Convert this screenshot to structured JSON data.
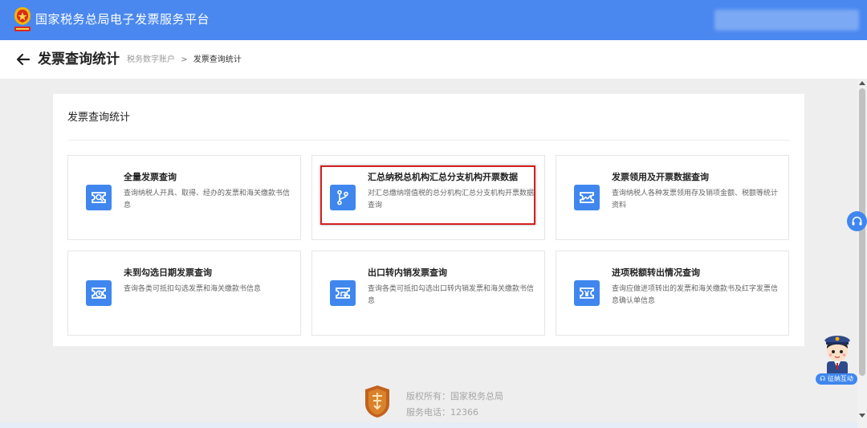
{
  "header": {
    "platform_title": "国家税务总局电子发票服务平台"
  },
  "subheader": {
    "page_title": "发票查询统计",
    "breadcrumb": [
      "税务数字账户",
      "发票查询统计"
    ],
    "breadcrumb_separator": ">"
  },
  "panel": {
    "title": "发票查询统计"
  },
  "cards": [
    {
      "title": "全量发票查询",
      "description": "查询纳税人开具、取得、经办的发票和海关缴款书信息",
      "icon": "search-document-icon"
    },
    {
      "title": "汇总纳税总机构汇总分支机构开票数据",
      "description": "对汇总缴纳增值税的总分机构汇总分支机构开票数据查询",
      "icon": "branch-icon"
    },
    {
      "title": "发票领用及开票数据查询",
      "description": "查询纳税人各种发票领用存及销项金额、税额等统计资料",
      "icon": "trend-chart-icon"
    },
    {
      "title": "未到勾选日期发票查询",
      "description": "查询各类可抵扣勾选发票和海关缴款书信息",
      "icon": "clock-document-icon"
    },
    {
      "title": "出口转内销发票查询",
      "description": "查询各类可抵扣勾选出口转内销发票和海关缴款书信息",
      "icon": "return-document-icon"
    },
    {
      "title": "进项税额转出情况查询",
      "description": "查询应做进项转出的发票和海关缴款书及红字发票信息确认单信息",
      "icon": "yen-document-icon"
    }
  ],
  "footer": {
    "copyright": "版权所有：国家税务总局",
    "service_phone": "服务电话：12366"
  },
  "floating": {
    "assistant_label": "征纳互动"
  },
  "colors": {
    "primary": "#4a88f0",
    "icon_bg": "#3f87ee",
    "highlight_border": "#d42020"
  }
}
